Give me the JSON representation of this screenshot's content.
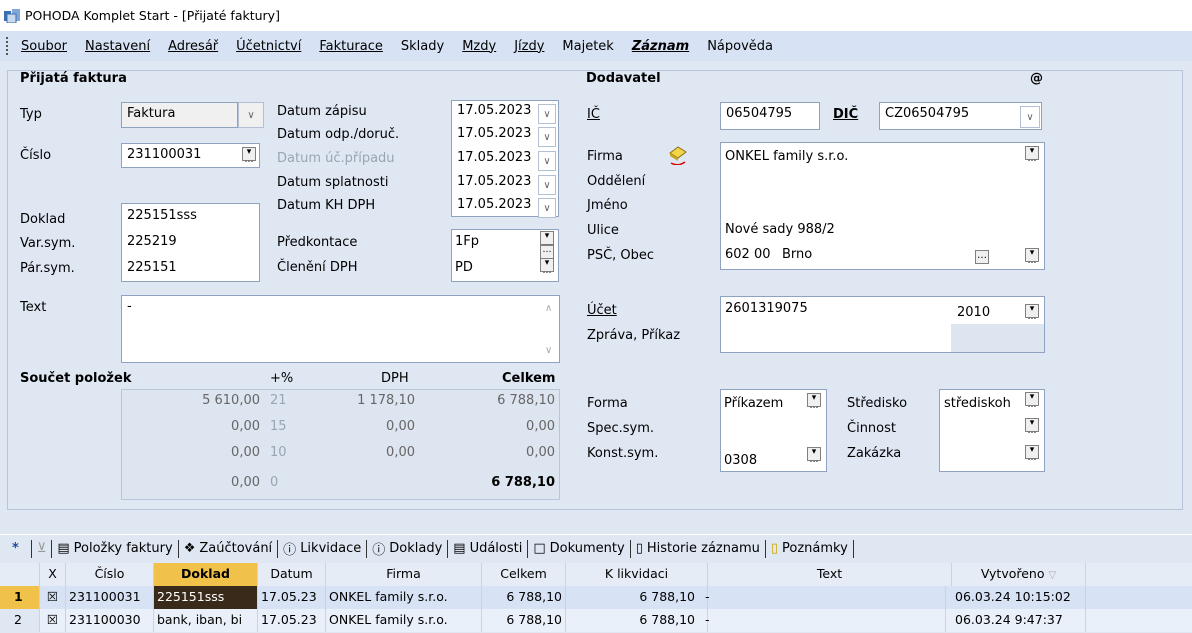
{
  "window": {
    "title": "POHODA Komplet Start - [Přijaté faktury]"
  },
  "menu": [
    "Soubor",
    "Nastavení",
    "Adresář",
    "Účetnictví",
    "Fakturace",
    "Sklady",
    "Mzdy",
    "Jízdy",
    "Majetek",
    "Záznam",
    "Nápověda"
  ],
  "invoice": {
    "section_label": "Přijatá faktura",
    "typ_label": "Typ",
    "typ_value": "Faktura",
    "cislo_label": "Číslo",
    "cislo_value": "231100031",
    "datum_zapisu_label": "Datum zápisu",
    "datum_zapisu": "17.05.2023",
    "datum_odp_label": "Datum odp./doruč.",
    "datum_odp": "17.05.2023",
    "datum_uc_label": "Datum úč.případu",
    "datum_uc": "17.05.2023",
    "datum_splatnosti_label": "Datum splatnosti",
    "datum_splatnosti": "17.05.2023",
    "datum_kh_label": "Datum KH DPH",
    "datum_kh": "17.05.2023",
    "doklad_label": "Doklad",
    "doklad_value": "225151sss",
    "varsym_label": "Var.sym.",
    "varsym_value": "225219",
    "parsym_label": "Pár.sym.",
    "parsym_value": "225151",
    "predkontace_label": "Předkontace",
    "predkontace_value": "1Fp",
    "cleneni_label": "Členění DPH",
    "cleneni_value": "PD",
    "text_label": "Text",
    "text_value": "-"
  },
  "summary": {
    "label": "Součet položek",
    "headers": [
      "+%",
      "DPH",
      "Celkem"
    ],
    "rows": [
      {
        "base": "5 610,00",
        "pct": "21",
        "dph": "1 178,10",
        "total": "6 788,10"
      },
      {
        "base": "0,00",
        "pct": "15",
        "dph": "0,00",
        "total": "0,00"
      },
      {
        "base": "0,00",
        "pct": "10",
        "dph": "0,00",
        "total": "0,00"
      },
      {
        "base": "0,00",
        "pct": "0",
        "dph": "",
        "total": "6 788,10"
      }
    ]
  },
  "supplier": {
    "section_label": "Dodavatel",
    "at_sign": "@",
    "ic_label": "IČ",
    "ic_value": "06504795",
    "dic_label": "DIČ",
    "dic_value": "CZ06504795",
    "firma_label": "Firma",
    "firma_value": "ONKEL family s.r.o.",
    "oddeleni_label": "Oddělení",
    "jmeno_label": "Jméno",
    "ulice_label": "Ulice",
    "ulice_value": "Nové sady 988/2",
    "psc_label": "PSČ, Obec",
    "psc_value": "602 00",
    "obec_value": "Brno",
    "ucet_label": "Účet",
    "ucet_value": "2601319075",
    "bank_code": "2010",
    "zprava_label": "Zpráva, Příkaz",
    "forma_label": "Forma",
    "forma_value": "Příkazem",
    "specsym_label": "Spec.sym.",
    "konstsym_label": "Konst.sym.",
    "konstsym_value": "0308",
    "stredisko_label": "Středisko",
    "stredisko_value": "střediskoh",
    "cinnost_label": "Činnost",
    "zakazka_label": "Zakázka"
  },
  "tabs": [
    "Položky faktury",
    "Zaúčtování",
    "Likvidace",
    "Doklady",
    "Události",
    "Dokumenty",
    "Historie záznamu",
    "Poznámky"
  ],
  "grid": {
    "headers": [
      "X",
      "Číslo",
      "Doklad",
      "Datum",
      "Firma",
      "Celkem",
      "K likvidaci",
      "Text",
      "Vytvořeno"
    ],
    "rows": [
      {
        "n": "1",
        "cislo": "231100031",
        "doklad": "225151sss",
        "datum": "17.05.23",
        "firma": "ONKEL family s.r.o.",
        "celkem": "6 788,10",
        "klikv": "6 788,10",
        "text": "-",
        "vytvoreno": "06.03.24 10:15:02"
      },
      {
        "n": "2",
        "cislo": "231100030",
        "doklad": "bank, iban, bi",
        "datum": "17.05.23",
        "firma": "ONKEL family s.r.o.",
        "celkem": "6 788,10",
        "klikv": "6 788,10",
        "text": "-",
        "vytvoreno": "06.03.24 9:47:37"
      }
    ]
  }
}
